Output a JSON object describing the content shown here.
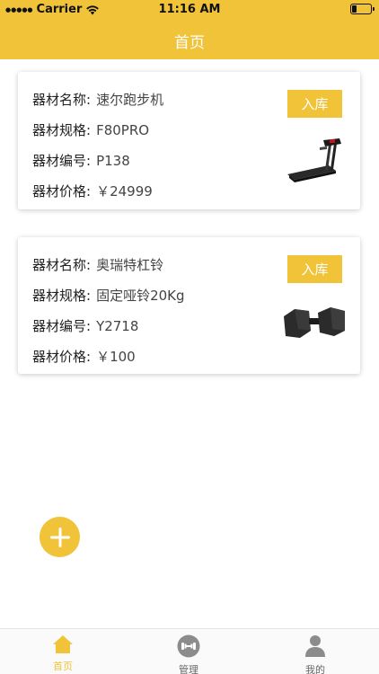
{
  "status_bar": {
    "carrier": "Carrier",
    "time": "11:16 AM"
  },
  "header": {
    "title": "首页"
  },
  "labels": {
    "name": "器材名称:",
    "spec": "器材规格:",
    "code": "器材编号:",
    "price": "器材价格:"
  },
  "equipment": [
    {
      "name": "速尔跑步机",
      "spec": "F80PRO",
      "code": "P138",
      "price": "￥24999",
      "button": "入库",
      "image": "treadmill"
    },
    {
      "name": "奥瑞特杠铃",
      "spec": "固定哑铃20Kg",
      "code": "Y2718",
      "price": "￥100",
      "button": "入库",
      "image": "dumbbell"
    }
  ],
  "fab": {
    "icon": "plus-icon"
  },
  "tabbar": {
    "items": [
      {
        "label": "首页",
        "icon": "home-icon",
        "active": true
      },
      {
        "label": "管理",
        "icon": "dumbbell-icon",
        "active": false
      },
      {
        "label": "我的",
        "icon": "user-icon",
        "active": false
      }
    ]
  },
  "colors": {
    "accent": "#f0c339",
    "inactive": "#666666"
  }
}
